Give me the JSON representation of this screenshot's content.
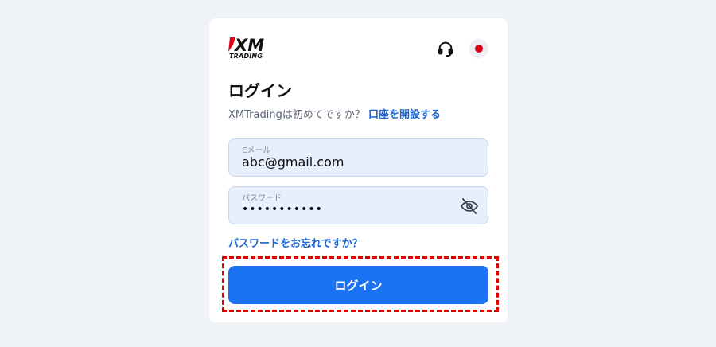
{
  "brand": {
    "logo_text": "XM",
    "logo_sub": "TRADING",
    "accent_color": "#1a73f2",
    "link_color": "#1a64d6"
  },
  "header": {
    "support_icon": "headset-icon",
    "language_icon": "japan-flag-icon"
  },
  "login": {
    "title": "ログイン",
    "signup_prompt": "XMTradingは初めてですか？",
    "signup_link": "口座を開設する",
    "email": {
      "label": "Eメール",
      "value": "abc@gmail.com"
    },
    "password": {
      "label": "パスワード",
      "value": "•••••••••••",
      "toggle_icon": "eye-off-icon"
    },
    "forgot_link": "パスワードをお忘れですか？",
    "submit_label": "ログイン"
  }
}
